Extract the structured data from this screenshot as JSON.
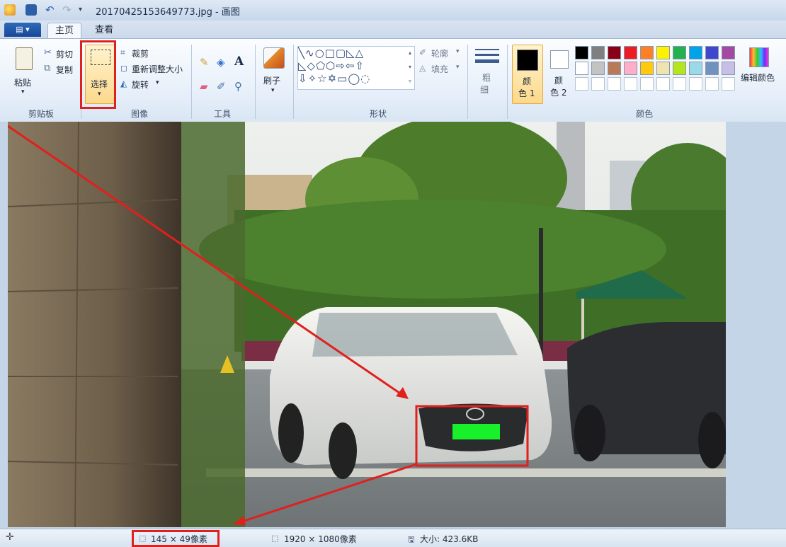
{
  "window": {
    "title": "20170425153649773.jpg - 画图"
  },
  "tabs": {
    "home": "主页",
    "view": "查看"
  },
  "ribbon": {
    "clipboard": {
      "paste": "粘贴",
      "cut": "剪切",
      "copy": "复制",
      "group_label": "剪贴板"
    },
    "image": {
      "select": "选择",
      "crop": "裁剪",
      "resize": "重新调整大小",
      "rotate": "旋转",
      "group_label": "图像"
    },
    "tools": {
      "group_label": "工具",
      "text_tool": "A"
    },
    "brushes": {
      "label": "刷子"
    },
    "shapes": {
      "outline": "轮廓",
      "fill": "填充",
      "group_label": "形状"
    },
    "size": {
      "label_line1": "粗",
      "label_line2": "细"
    },
    "colors": {
      "color1_line1": "颜",
      "color1_line2": "色 1",
      "color2_line1": "颜",
      "color2_line2": "色 2",
      "edit_colors": "编辑颜色",
      "group_label": "颜色",
      "palette_row1": [
        "#000000",
        "#7f7f7f",
        "#880015",
        "#ed1c24",
        "#ff7f27",
        "#fff200",
        "#22b14c",
        "#00a2e8",
        "#3f48cc",
        "#a349a4"
      ],
      "palette_row2": [
        "#ffffff",
        "#c3c3c3",
        "#b97a57",
        "#ffaec9",
        "#ffc90e",
        "#efe4b0",
        "#b5e61d",
        "#99d9ea",
        "#7092be",
        "#c8bfe7"
      ]
    }
  },
  "status": {
    "selection_size": "145 × 49像素",
    "image_size": "1920 × 1080像素",
    "file_size": "大小: 423.6KB"
  },
  "colors": {
    "accent_red": "#e0201c",
    "selected_button_bg": "#fcd98b",
    "plate_green": "#18f02a"
  }
}
